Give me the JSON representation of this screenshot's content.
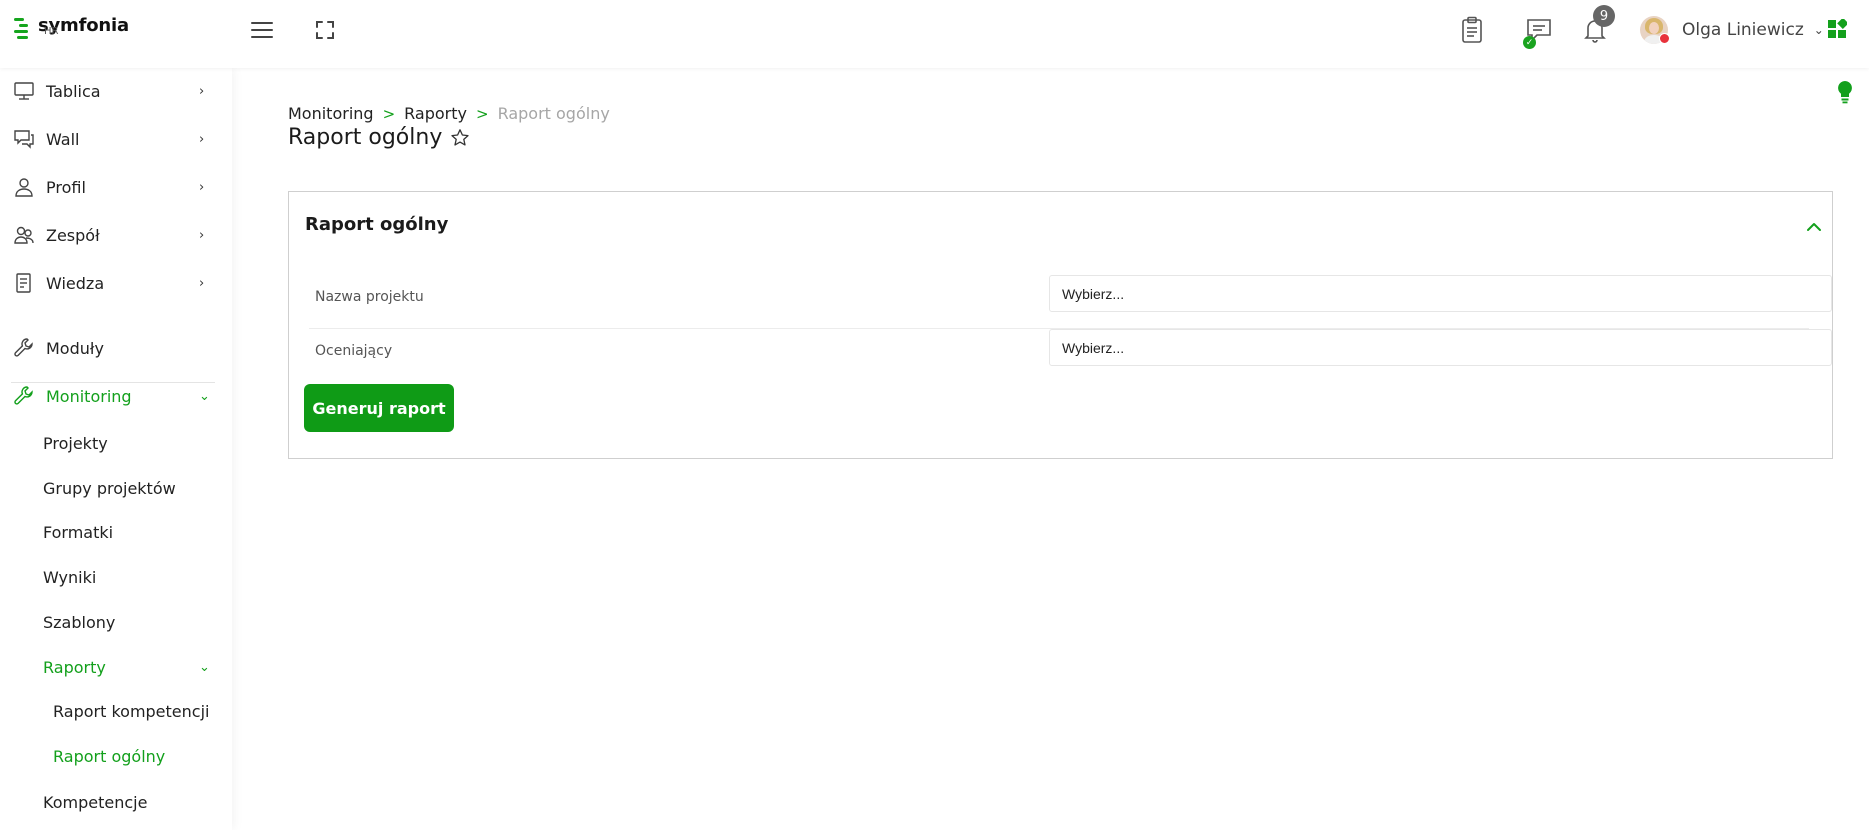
{
  "brand": {
    "name": "symfonia",
    "sub": "HR",
    "accent": "#13a01c"
  },
  "topbar": {
    "notification_count": "9",
    "user_name": "Olga Liniewicz",
    "icons": [
      "hamburger-menu-icon",
      "fullscreen-icon",
      "clipboard-icon",
      "chat-icon",
      "bell-icon",
      "apps-grid-icon",
      "lightbulb-icon"
    ]
  },
  "sidebar": {
    "items": [
      {
        "label": "Tablica",
        "icon": "monitor-icon"
      },
      {
        "label": "Wall",
        "icon": "comments-icon"
      },
      {
        "label": "Profil",
        "icon": "user-icon"
      },
      {
        "label": "Zespół",
        "icon": "team-icon"
      },
      {
        "label": "Wiedza",
        "icon": "book-icon"
      },
      {
        "label": "Moduły",
        "icon": "wrench-icon"
      },
      {
        "label": "Monitoring",
        "icon": "wrench-icon"
      }
    ],
    "monitoring_children": [
      {
        "label": "Projekty"
      },
      {
        "label": "Grupy projektów"
      },
      {
        "label": "Formatki"
      },
      {
        "label": "Wyniki"
      },
      {
        "label": "Szablony"
      },
      {
        "label": "Raporty"
      },
      {
        "label": "Kompetencje"
      }
    ],
    "raporty_children": [
      {
        "label": "Raport kompetencji"
      },
      {
        "label": "Raport ogólny"
      }
    ]
  },
  "breadcrumb": [
    "Monitoring",
    "Raporty",
    "Raport ogólny"
  ],
  "page": {
    "title": "Raport ogólny"
  },
  "card": {
    "title": "Raport ogólny",
    "fields": [
      {
        "label": "Nazwa projektu",
        "value": "Wybierz..."
      },
      {
        "label": "Oceniający",
        "value": "Wybierz..."
      }
    ],
    "button_label": "Generuj raport"
  }
}
